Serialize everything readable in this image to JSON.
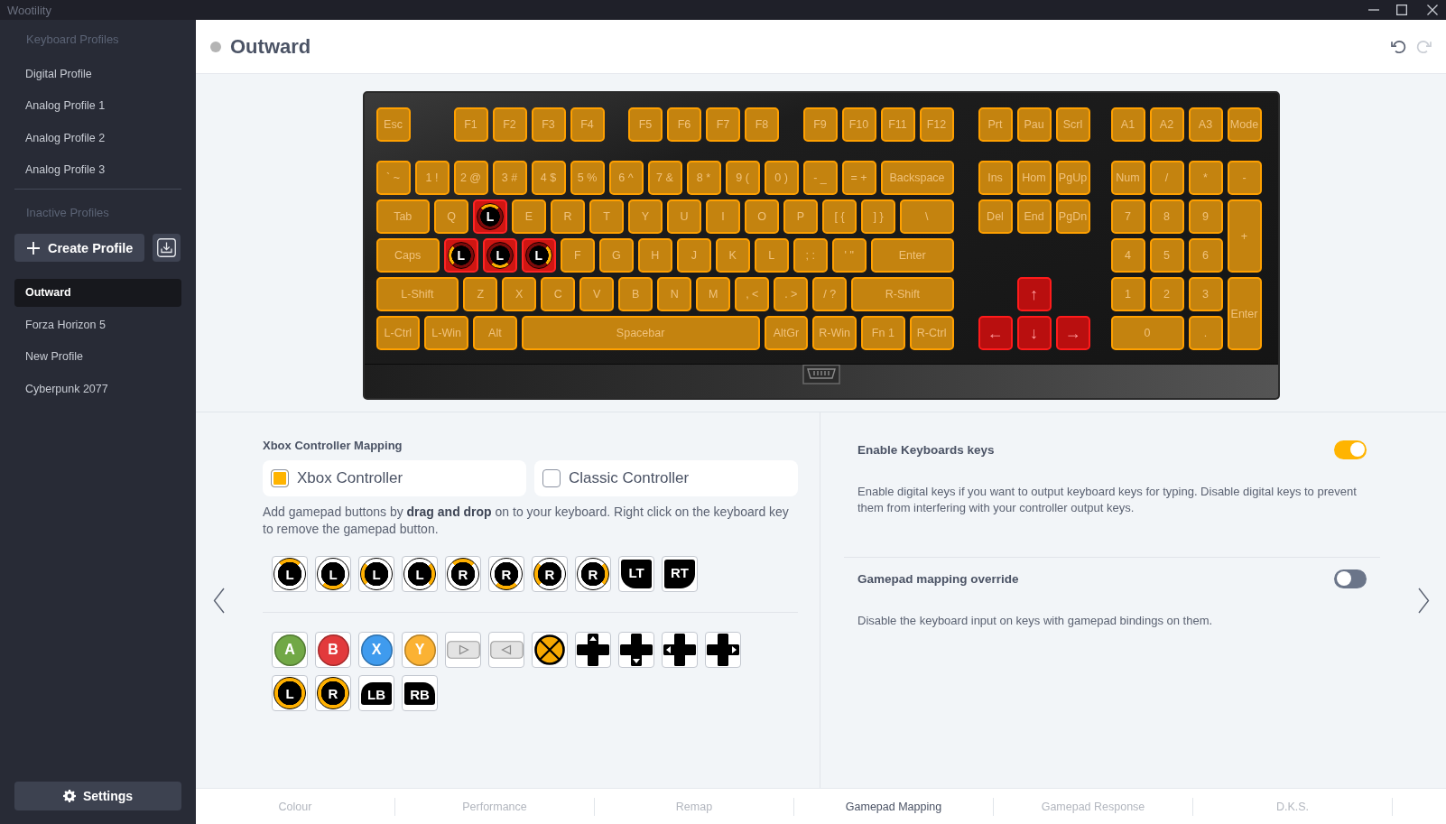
{
  "window": {
    "title": "Wootility"
  },
  "sidebar": {
    "active_heading": "Keyboard Profiles",
    "active_profiles": [
      {
        "label": "Digital Profile",
        "selected": false
      },
      {
        "label": "Analog Profile 1",
        "selected": false
      },
      {
        "label": "Analog Profile 2",
        "selected": false
      },
      {
        "label": "Analog Profile 3",
        "selected": false
      }
    ],
    "inactive_heading": "Inactive Profiles",
    "create_button": "Create Profile",
    "inactive_profiles": [
      {
        "label": "Outward",
        "selected": true
      },
      {
        "label": "Forza Horizon 5",
        "selected": false
      },
      {
        "label": "New Profile",
        "selected": false
      },
      {
        "label": "Cyberpunk 2077",
        "selected": false
      }
    ],
    "settings_button": "Settings"
  },
  "header": {
    "title": "Outward",
    "history_buttons": [
      {
        "kind": "undo",
        "disabled": false
      },
      {
        "kind": "redo",
        "disabled": true
      }
    ]
  },
  "keyboard": {
    "main_rows": [
      [
        {
          "label": "Esc",
          "kind": "plain"
        },
        {
          "label": "F1",
          "kind": "plain"
        },
        {
          "label": "F2",
          "kind": "plain"
        },
        {
          "label": "F3",
          "kind": "plain"
        },
        {
          "label": "F4",
          "kind": "plain"
        },
        {
          "label": "F5",
          "kind": "plain"
        },
        {
          "label": "F6",
          "kind": "plain"
        },
        {
          "label": "F7",
          "kind": "plain"
        },
        {
          "label": "F8",
          "kind": "plain"
        },
        {
          "label": "F9",
          "kind": "plain"
        },
        {
          "label": "F10",
          "kind": "plain"
        },
        {
          "label": "F11",
          "kind": "plain"
        },
        {
          "label": "F12",
          "kind": "plain"
        }
      ],
      [
        {
          "label": "` ~",
          "kind": "plain"
        },
        {
          "label": "1 !",
          "kind": "plain"
        },
        {
          "label": "2 @",
          "kind": "plain"
        },
        {
          "label": "3 #",
          "kind": "plain"
        },
        {
          "label": "4 $",
          "kind": "plain"
        },
        {
          "label": "5 %",
          "kind": "plain"
        },
        {
          "label": "6 ^",
          "kind": "plain"
        },
        {
          "label": "7 &",
          "kind": "plain"
        },
        {
          "label": "8 *",
          "kind": "plain"
        },
        {
          "label": "9 (",
          "kind": "plain"
        },
        {
          "label": "0 )",
          "kind": "plain"
        },
        {
          "label": "- _",
          "kind": "plain"
        },
        {
          "label": "= +",
          "kind": "plain"
        },
        {
          "label": "Backspace",
          "kind": "plain"
        }
      ],
      [
        {
          "label": "Tab",
          "kind": "plain"
        },
        {
          "label": "Q",
          "kind": "plain"
        },
        {
          "label": "L",
          "kind": "stick-up"
        },
        {
          "label": "E",
          "kind": "plain"
        },
        {
          "label": "R",
          "kind": "plain"
        },
        {
          "label": "T",
          "kind": "plain"
        },
        {
          "label": "Y",
          "kind": "plain"
        },
        {
          "label": "U",
          "kind": "plain"
        },
        {
          "label": "I",
          "kind": "plain"
        },
        {
          "label": "O",
          "kind": "plain"
        },
        {
          "label": "P",
          "kind": "plain"
        },
        {
          "label": "[ {",
          "kind": "plain"
        },
        {
          "label": "] }",
          "kind": "plain"
        },
        {
          "label": "\\",
          "kind": "plain"
        }
      ],
      [
        {
          "label": "Caps",
          "kind": "plain"
        },
        {
          "label": "L",
          "kind": "stick-left"
        },
        {
          "label": "L",
          "kind": "stick-down"
        },
        {
          "label": "L",
          "kind": "stick-right"
        },
        {
          "label": "F",
          "kind": "plain"
        },
        {
          "label": "G",
          "kind": "plain"
        },
        {
          "label": "H",
          "kind": "plain"
        },
        {
          "label": "J",
          "kind": "plain"
        },
        {
          "label": "K",
          "kind": "plain"
        },
        {
          "label": "L",
          "kind": "plain"
        },
        {
          "label": "; :",
          "kind": "plain"
        },
        {
          "label": "' \"",
          "kind": "plain"
        },
        {
          "label": "Enter",
          "kind": "plain"
        }
      ],
      [
        {
          "label": "L-Shift",
          "kind": "plain"
        },
        {
          "label": "Z",
          "kind": "plain"
        },
        {
          "label": "X",
          "kind": "plain"
        },
        {
          "label": "C",
          "kind": "plain"
        },
        {
          "label": "V",
          "kind": "plain"
        },
        {
          "label": "B",
          "kind": "plain"
        },
        {
          "label": "N",
          "kind": "plain"
        },
        {
          "label": "M",
          "kind": "plain"
        },
        {
          "label": ", <",
          "kind": "plain"
        },
        {
          "label": ". >",
          "kind": "plain"
        },
        {
          "label": "/ ?",
          "kind": "plain"
        },
        {
          "label": "R-Shift",
          "kind": "plain"
        }
      ],
      [
        {
          "label": "L-Ctrl",
          "kind": "plain"
        },
        {
          "label": "L-Win",
          "kind": "plain"
        },
        {
          "label": "Alt",
          "kind": "plain"
        },
        {
          "label": "Spacebar",
          "kind": "plain"
        },
        {
          "label": "AltGr",
          "kind": "plain"
        },
        {
          "label": "R-Win",
          "kind": "plain"
        },
        {
          "label": "Fn 1",
          "kind": "plain"
        },
        {
          "label": "R-Ctrl",
          "kind": "plain"
        }
      ]
    ],
    "nav_keys": [
      {
        "label": "Prt",
        "kind": "plain"
      },
      {
        "label": "Pau",
        "kind": "plain"
      },
      {
        "label": "Scrl",
        "kind": "plain"
      },
      {
        "label": "Ins",
        "kind": "plain"
      },
      {
        "label": "Hom",
        "kind": "plain"
      },
      {
        "label": "PgUp",
        "kind": "plain"
      },
      {
        "label": "Del",
        "kind": "plain"
      },
      {
        "label": "End",
        "kind": "plain"
      },
      {
        "label": "PgDn",
        "kind": "plain"
      },
      {
        "label": "↑",
        "kind": "bound"
      },
      {
        "label": "←",
        "kind": "bound"
      },
      {
        "label": "↓",
        "kind": "bound"
      },
      {
        "label": "→",
        "kind": "bound"
      }
    ],
    "numpad_keys": [
      {
        "label": "A1",
        "kind": "plain"
      },
      {
        "label": "A2",
        "kind": "plain"
      },
      {
        "label": "A3",
        "kind": "plain"
      },
      {
        "label": "Mode",
        "kind": "plain"
      },
      {
        "label": "Num",
        "kind": "plain"
      },
      {
        "label": "/",
        "kind": "plain"
      },
      {
        "label": "*",
        "kind": "plain"
      },
      {
        "label": "-",
        "kind": "plain"
      },
      {
        "label": "7",
        "kind": "plain"
      },
      {
        "label": "8",
        "kind": "plain"
      },
      {
        "label": "9",
        "kind": "plain"
      },
      {
        "label": "+",
        "kind": "plain"
      },
      {
        "label": "4",
        "kind": "plain"
      },
      {
        "label": "5",
        "kind": "plain"
      },
      {
        "label": "6",
        "kind": "plain"
      },
      {
        "label": "1",
        "kind": "plain"
      },
      {
        "label": "2",
        "kind": "plain"
      },
      {
        "label": "3",
        "kind": "plain"
      },
      {
        "label": "Enter",
        "kind": "plain"
      },
      {
        "label": "0",
        "kind": "plain"
      },
      {
        "label": ".",
        "kind": "plain"
      }
    ]
  },
  "mapping": {
    "heading": "Xbox Controller Mapping",
    "controller_types": [
      {
        "label": "Xbox Controller",
        "selected": true
      },
      {
        "label": "Classic Controller",
        "selected": false
      }
    ],
    "hint": "Add gamepad buttons by **drag and drop** on to your keyboard. Right click on the keyboard key to remove the gamepad button.",
    "axis_buttons": [
      {
        "kind": "stick-up",
        "label": "L"
      },
      {
        "kind": "stick-down",
        "label": "L"
      },
      {
        "kind": "stick-left",
        "label": "L"
      },
      {
        "kind": "stick-right",
        "label": "L"
      },
      {
        "kind": "stick-up",
        "label": "R"
      },
      {
        "kind": "stick-down",
        "label": "R"
      },
      {
        "kind": "stick-left",
        "label": "R"
      },
      {
        "kind": "stick-right",
        "label": "R"
      },
      {
        "kind": "trigger-left",
        "label": "LT"
      },
      {
        "kind": "trigger-right",
        "label": "RT"
      }
    ],
    "buttons": [
      {
        "kind": "face",
        "label": "A",
        "color": "#71a846"
      },
      {
        "kind": "face",
        "label": "B",
        "color": "#e23a3c"
      },
      {
        "kind": "face",
        "label": "X",
        "color": "#3f9bee"
      },
      {
        "kind": "face",
        "label": "Y",
        "color": "#fbb233"
      },
      {
        "kind": "pad-right"
      },
      {
        "kind": "pad-left"
      },
      {
        "kind": "guide"
      },
      {
        "kind": "dpad-up"
      },
      {
        "kind": "dpad-down"
      },
      {
        "kind": "dpad-left"
      },
      {
        "kind": "dpad-right"
      },
      {
        "kind": "stick-press",
        "label": "L"
      },
      {
        "kind": "stick-press",
        "label": "R"
      },
      {
        "kind": "bumper-left",
        "label": "LB"
      },
      {
        "kind": "bumper-right",
        "label": "RB"
      }
    ]
  },
  "options": [
    {
      "title": "Enable Keyboards keys",
      "description": "Enable digital keys if you want to output keyboard keys for typing. Disable digital keys to prevent them from interfering with your controller output keys.",
      "on": true
    },
    {
      "title": "Gamepad mapping override",
      "description": "Disable the keyboard input on keys with gamepad bindings on them.",
      "on": false
    }
  ],
  "tabs": [
    {
      "label": "Colour",
      "selected": false
    },
    {
      "label": "Performance",
      "selected": false
    },
    {
      "label": "Remap",
      "selected": false
    },
    {
      "label": "Gamepad Mapping",
      "selected": true
    },
    {
      "label": "Gamepad Response",
      "selected": false
    },
    {
      "label": "D.K.S.",
      "selected": false
    }
  ]
}
